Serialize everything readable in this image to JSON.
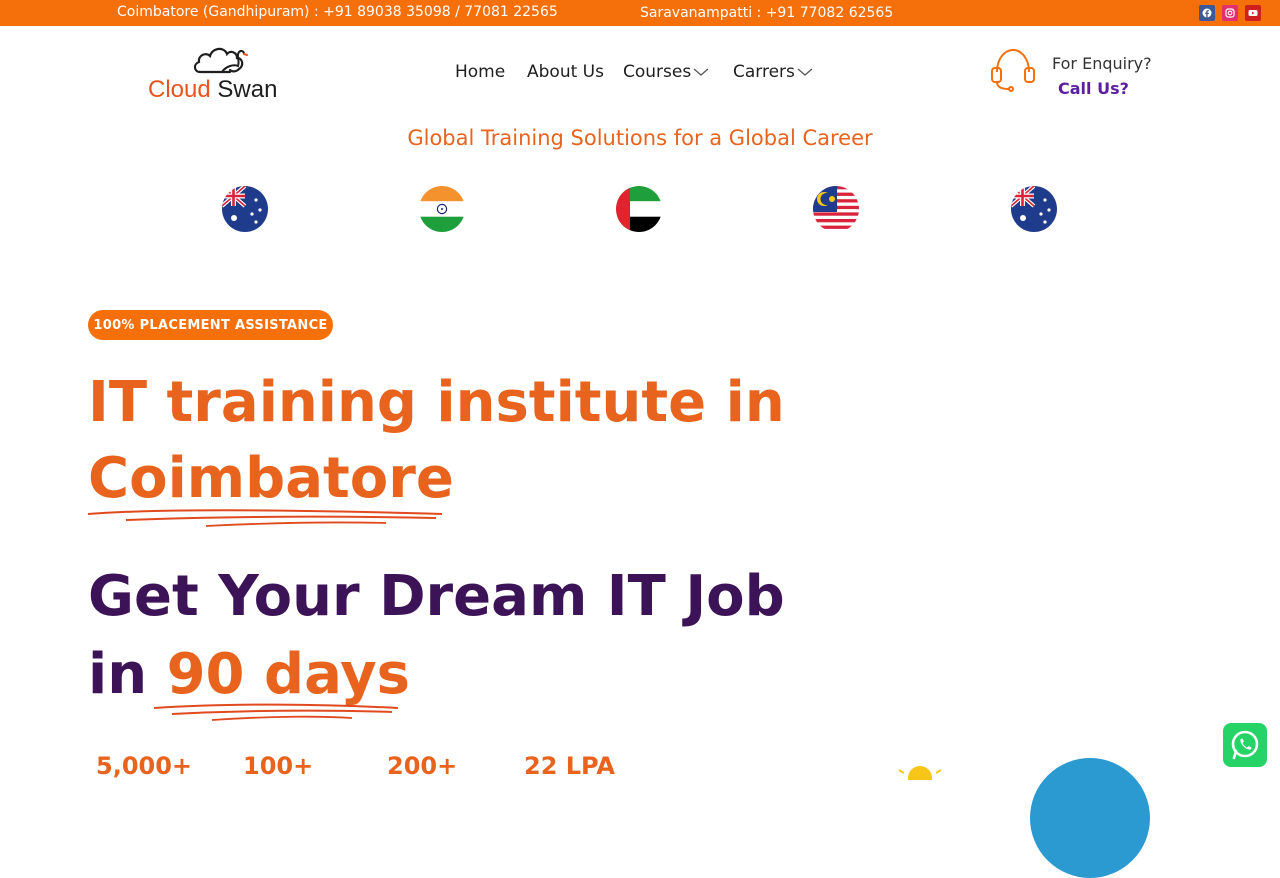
{
  "topbar": {
    "contact_left": "Coimbatore (Gandhipuram) : +91 89038 35098 / 77081 22565",
    "contact_mid": "Saravanampatti : +91 77082 62565",
    "social": [
      "facebook-icon",
      "instagram-icon",
      "youtube-icon"
    ]
  },
  "brand": {
    "name_part1": "Cloud",
    "name_part2": "Swan",
    "color_primary": "#e8541e",
    "color_dark": "#1e1e1e"
  },
  "nav": {
    "items": [
      {
        "label": "Home"
      },
      {
        "label": "About Us"
      },
      {
        "label": "Courses"
      },
      {
        "label": "Carrers"
      }
    ]
  },
  "enquiry": {
    "line1": "For Enquiry?",
    "line2": "Call Us?"
  },
  "tagline": "Global Training Solutions for a Global Career",
  "flags": [
    "australia-flag",
    "india-flag",
    "uae-flag",
    "malaysia-flag",
    "australia-flag"
  ],
  "hero": {
    "badge": "100% PLACEMENT ASSISTANCE",
    "title_line1": "IT training institute in",
    "title_line2": "Coimbatore",
    "subtitle_line1": "Get Your Dream IT Job",
    "subtitle_line2_prefix": "in",
    "subtitle_line2_highlight": "90 days"
  },
  "stats": [
    {
      "value": "5,000+"
    },
    {
      "value": "100+"
    },
    {
      "value": "200+"
    },
    {
      "value": "22 LPA"
    }
  ],
  "colors": {
    "orange": "#f5700a",
    "accent": "#e8641e",
    "purple": "#3d1358",
    "link_purple": "#5b1fa0",
    "whatsapp": "#25d366"
  }
}
